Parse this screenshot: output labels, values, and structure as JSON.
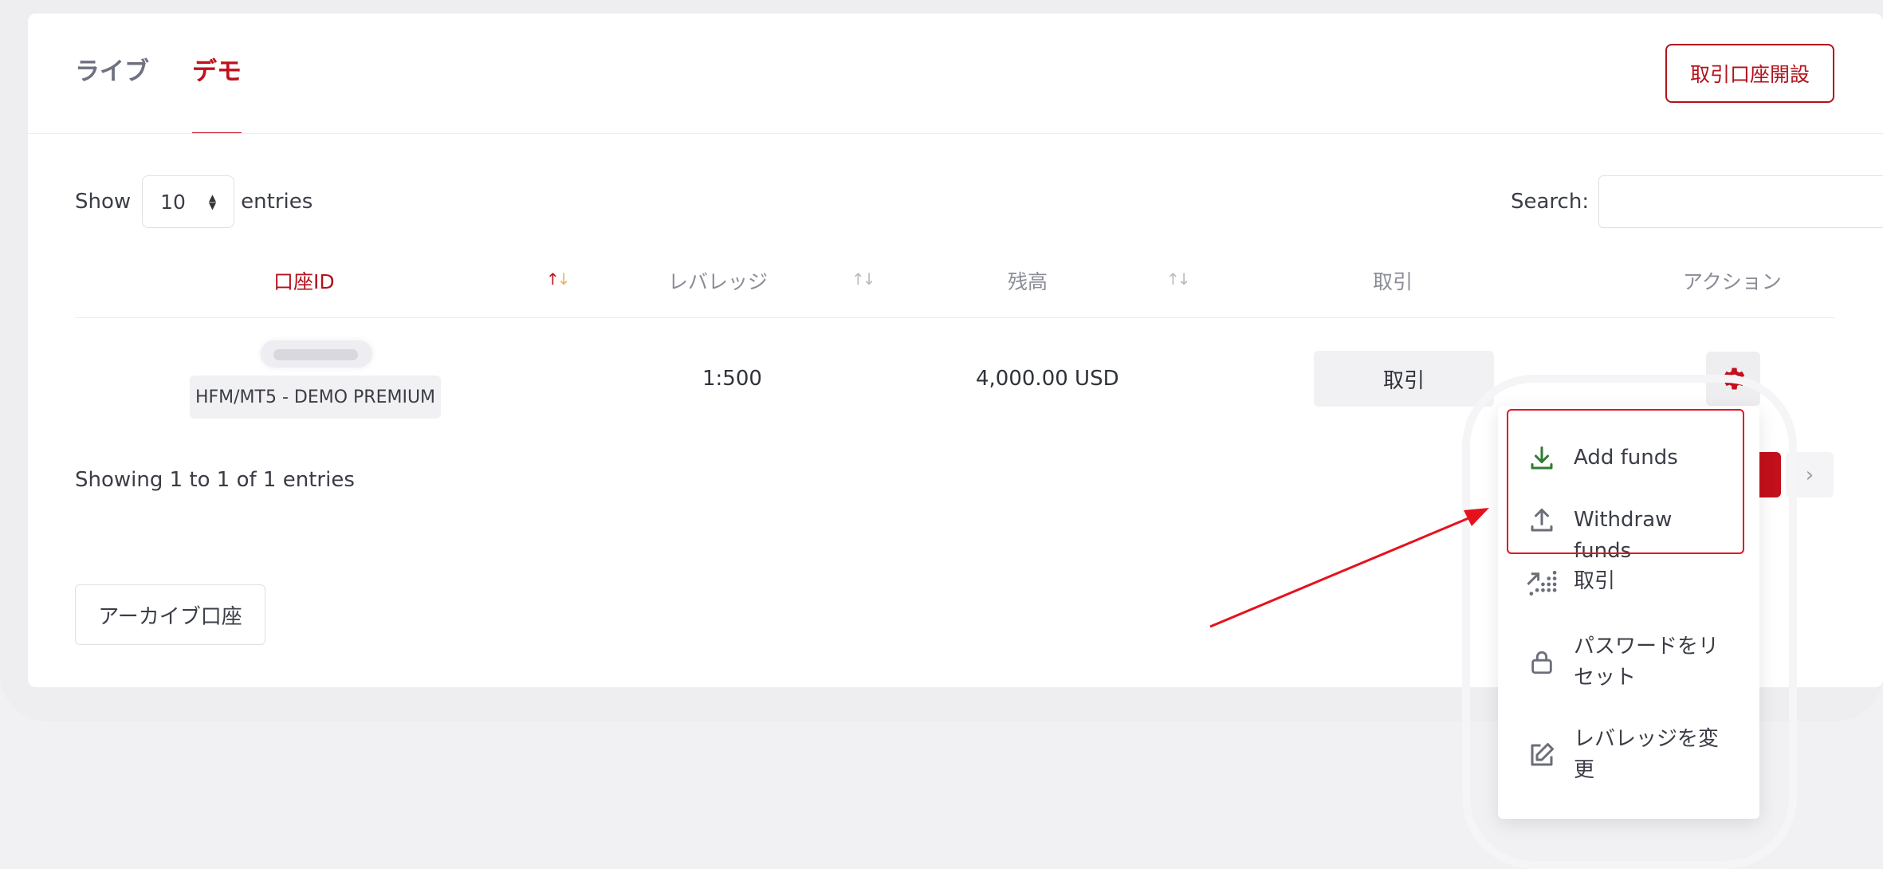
{
  "tabs": [
    {
      "label": "ライブ",
      "active": false
    },
    {
      "label": "デモ",
      "active": true
    }
  ],
  "open_account_label": "取引口座開設",
  "show": {
    "prefix": "Show",
    "value": "10",
    "suffix": "entries"
  },
  "search": {
    "label": "Search:",
    "value": ""
  },
  "table": {
    "headers": [
      "口座ID",
      "レバレッジ",
      "残高",
      "取引",
      "アクション"
    ],
    "row": {
      "platform": "HFM/MT5 - DEMO PREMIUM",
      "leverage": "1:500",
      "balance": "4,000.00 USD",
      "trade_label": "取引"
    }
  },
  "showing_text": "Showing 1 to 1 of 1 entries",
  "archive_label": "アーカイブ口座",
  "menu": {
    "items": [
      {
        "label": "Add funds",
        "icon": "download-icon"
      },
      {
        "label": "Withdraw funds",
        "icon": "upload-icon"
      },
      {
        "label": "取引",
        "icon": "trade-chart-icon"
      },
      {
        "label": "パスワードをリセット",
        "icon": "lock-icon"
      },
      {
        "label": "レバレッジを変更",
        "icon": "edit-icon"
      }
    ]
  },
  "colors": {
    "brand": "#c2101c",
    "annotation": "#e5121d"
  }
}
